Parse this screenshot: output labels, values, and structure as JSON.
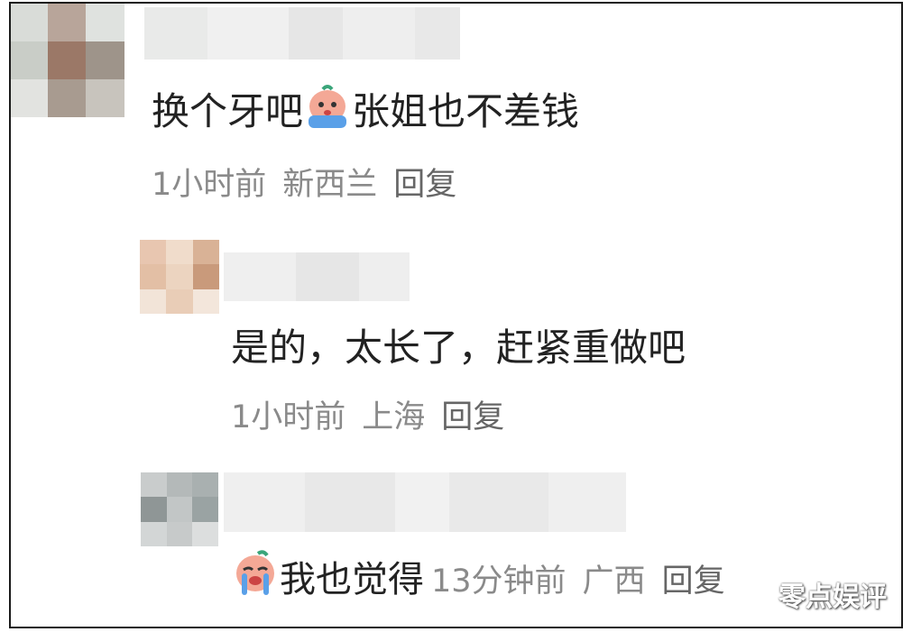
{
  "comments": [
    {
      "text_before": "换个牙吧",
      "emoji_1": "crying-face-icon",
      "text_after": "张姐也不差钱",
      "time": "1小时前",
      "location": "新西兰",
      "reply": "回复"
    },
    {
      "text": "是的，太长了，赶紧重做吧",
      "time": "1小时前",
      "location": "上海",
      "reply": "回复"
    },
    {
      "emoji_1": "crying-face-icon",
      "text": "我也觉得",
      "time": "13分钟前",
      "location": "广西",
      "reply": "回复"
    }
  ],
  "watermark": "零点娱评",
  "colors": {
    "text": "#222222",
    "meta": "#8a8a8a",
    "border": "#1a1a1a"
  }
}
